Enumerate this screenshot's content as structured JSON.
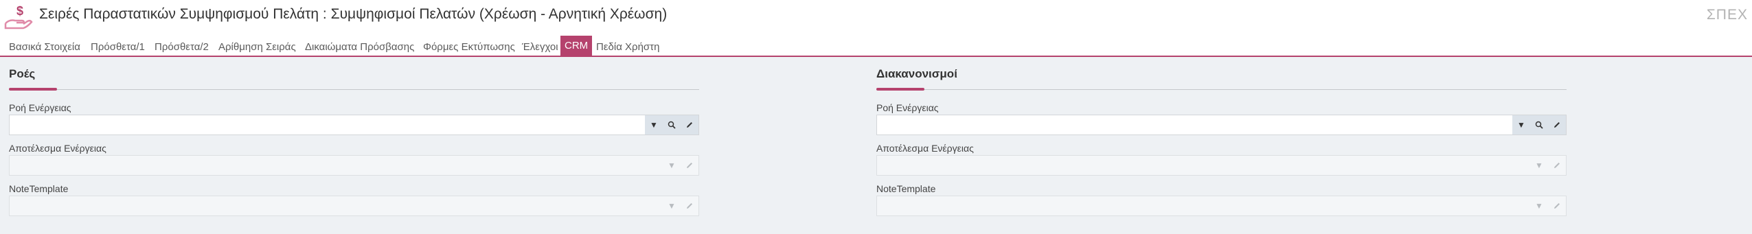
{
  "header": {
    "title": "Σειρές Παραστατικών Συμψηφισμού Πελάτη : Συμψηφισμοί Πελατών (Χρέωση - Αρνητική Χρέωση)",
    "corner_code": "ΣΠΕΧ",
    "icon": "hand-money-icon",
    "accent_color": "#b5426d"
  },
  "tabs": [
    {
      "label": "Βασικά Στοιχεία",
      "active": false
    },
    {
      "label": "Πρόσθετα/1",
      "active": false
    },
    {
      "label": "Πρόσθετα/2",
      "active": false
    },
    {
      "label": "Αρίθμηση Σειράς",
      "active": false
    },
    {
      "label": "Δικαιώματα Πρόσβασης",
      "active": false
    },
    {
      "label": "Φόρμες Εκτύπωσης",
      "active": false
    },
    {
      "label": "Έλεγχοι",
      "active": false
    },
    {
      "label": "CRM",
      "active": true
    },
    {
      "label": "Πεδία Χρήστη",
      "active": false
    }
  ],
  "sections": {
    "left": {
      "title": "Ροές",
      "fields": [
        {
          "label": "Ροή Ενέργειας",
          "value": "",
          "enabled": true
        },
        {
          "label": "Αποτέλεσμα Ενέργειας",
          "value": "",
          "enabled": false
        },
        {
          "label": "NoteTemplate",
          "value": "",
          "enabled": false
        }
      ]
    },
    "right": {
      "title": "Διακανονισμοί",
      "fields": [
        {
          "label": "Ροή Ενέργειας",
          "value": "",
          "enabled": true
        },
        {
          "label": "Αποτέλεσμα Ενέργειας",
          "value": "",
          "enabled": false
        },
        {
          "label": "NoteTemplate",
          "value": "",
          "enabled": false
        }
      ]
    }
  },
  "icons": {
    "dropdown": "chevron-down-icon",
    "search": "search-icon",
    "edit": "pencil-icon"
  }
}
